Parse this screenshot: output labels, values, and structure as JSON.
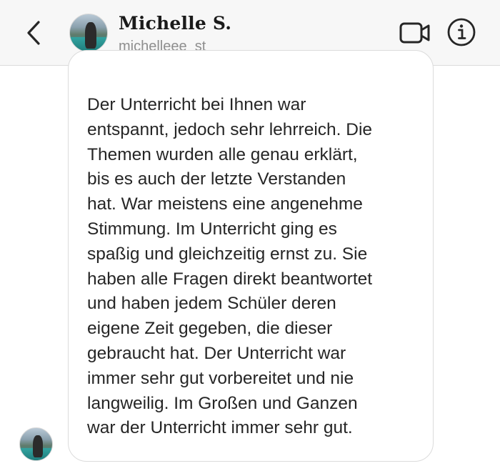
{
  "header": {
    "user_name": "Michelle S.",
    "user_handle": "michelleee_st",
    "icons": {
      "back": "chevron-left-icon",
      "video": "video-camera-icon",
      "info": "info-icon"
    }
  },
  "message": {
    "lines": [
      "Der Unterricht bei Ihnen war",
      "entspannt, jedoch sehr lehrreich. Die",
      "Themen wurden alle genau erklärt,",
      "bis es auch der letzte Verstanden",
      "hat. War meistens eine angenehme",
      "Stimmung. Im Unterricht ging es",
      "spaßig und gleichzeitig ernst zu. Sie",
      "haben alle Fragen direkt beantwortet",
      "und haben jedem Schüler deren",
      "eigene Zeit gegeben, die dieser",
      "gebraucht hat. Der Unterricht war",
      "immer sehr gut vorbereitet und nie",
      "langweilig. Im Großen und Ganzen",
      "war der Unterricht immer sehr gut."
    ]
  },
  "colors": {
    "header_bg": "#f7f7f7",
    "text": "#262626",
    "secondary_text": "#8e8e8e",
    "bubble_border": "#dbdbdb"
  }
}
